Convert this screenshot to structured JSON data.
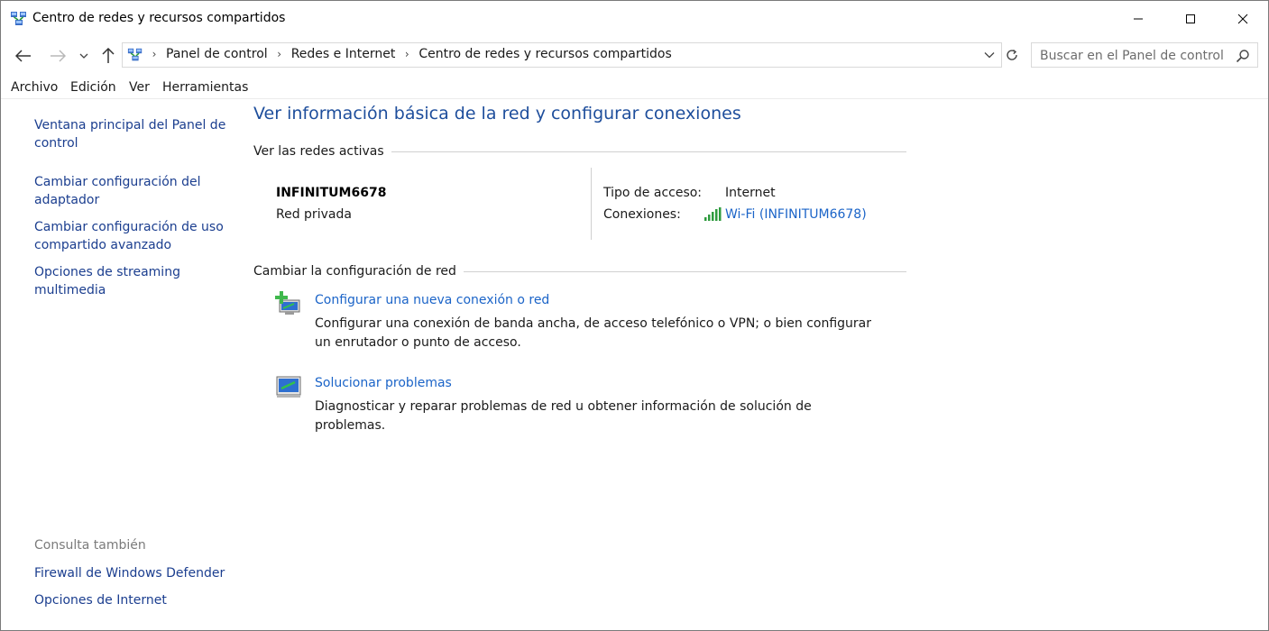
{
  "window": {
    "title": "Centro de redes y recursos compartidos"
  },
  "address": {
    "crumbs": [
      "Panel de control",
      "Redes e Internet",
      "Centro de redes y recursos compartidos"
    ]
  },
  "search": {
    "placeholder": "Buscar en el Panel de control"
  },
  "menu": [
    "Archivo",
    "Edición",
    "Ver",
    "Herramientas"
  ],
  "sidebar": {
    "links": [
      "Ventana principal del Panel de control",
      "Cambiar configuración del adaptador",
      "Cambiar configuración de uso compartido avanzado",
      "Opciones de streaming multimedia"
    ],
    "see_also_title": "Consulta también",
    "see_also": [
      "Firewall de Windows Defender",
      "Opciones de Internet"
    ]
  },
  "main": {
    "title": "Ver información básica de la red y configurar conexiones",
    "active_section": "Ver las redes activas",
    "network": {
      "name": "INFINITUM6678",
      "type": "Red privada",
      "access_label": "Tipo de acceso:",
      "access_value": "Internet",
      "connections_label": "Conexiones:",
      "connections_value": "Wi-Fi (INFINITUM6678)"
    },
    "change_section": "Cambiar la configuración de red",
    "tasks": [
      {
        "icon": "new-connection-icon",
        "link": "Configurar una nueva conexión o red",
        "desc": "Configurar una conexión de banda ancha, de acceso telefónico o VPN; o bien configurar un enrutador o punto de acceso."
      },
      {
        "icon": "troubleshoot-icon",
        "link": "Solucionar problemas",
        "desc": "Diagnosticar y reparar problemas de red u obtener información de solución de problemas."
      }
    ]
  },
  "colors": {
    "link": "#1b64c8",
    "title": "#1e4e9c",
    "sidebar_link": "#1b3e8f"
  }
}
